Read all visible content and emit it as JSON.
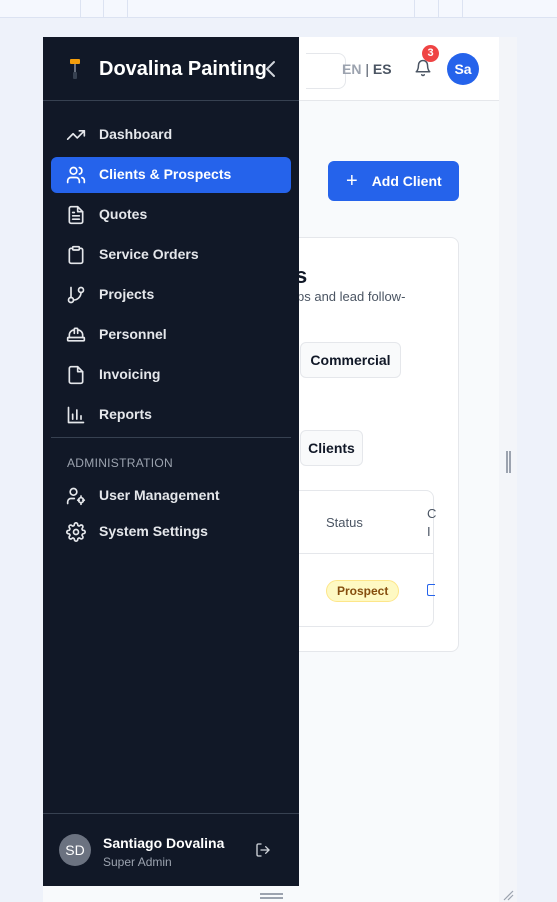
{
  "app": {
    "brand": "Dovalina Painting"
  },
  "header": {
    "lang_en": "EN",
    "lang_sep": "|",
    "lang_es": "ES",
    "notification_count": "3",
    "user_initials": "Sa"
  },
  "sidebar": {
    "items": [
      {
        "label": "Dashboard",
        "icon": "trending-up-icon"
      },
      {
        "label": "Clients & Prospects",
        "icon": "users-icon",
        "active": true
      },
      {
        "label": "Quotes",
        "icon": "file-text-icon"
      },
      {
        "label": "Service Orders",
        "icon": "clipboard-icon"
      },
      {
        "label": "Projects",
        "icon": "git-branch-icon"
      },
      {
        "label": "Personnel",
        "icon": "hard-hat-icon"
      },
      {
        "label": "Invoicing",
        "icon": "file-icon"
      },
      {
        "label": "Reports",
        "icon": "bar-chart-icon"
      }
    ],
    "admin_section_label": "ADMINISTRATION",
    "admin_items": [
      {
        "label": "User Management",
        "icon": "user-cog-icon"
      },
      {
        "label": "System Settings",
        "icon": "gear-icon"
      }
    ],
    "user": {
      "initials": "SD",
      "name": "Santiago Dovalina",
      "role": "Super Admin"
    }
  },
  "main": {
    "add_client_label": "Add Client",
    "card_title_fragment": "s",
    "card_subtitle_fragment": "ps and lead follow-",
    "filter_commercial": "Commercial",
    "tab_clients": "Clients",
    "table": {
      "col_status": "Status",
      "col_c_line1": "C",
      "col_c_line2": "I",
      "row_status": "Prospect"
    }
  },
  "colors": {
    "accent": "#2563eb",
    "sidebar_bg": "#111827",
    "badge_red": "#ef4444"
  }
}
